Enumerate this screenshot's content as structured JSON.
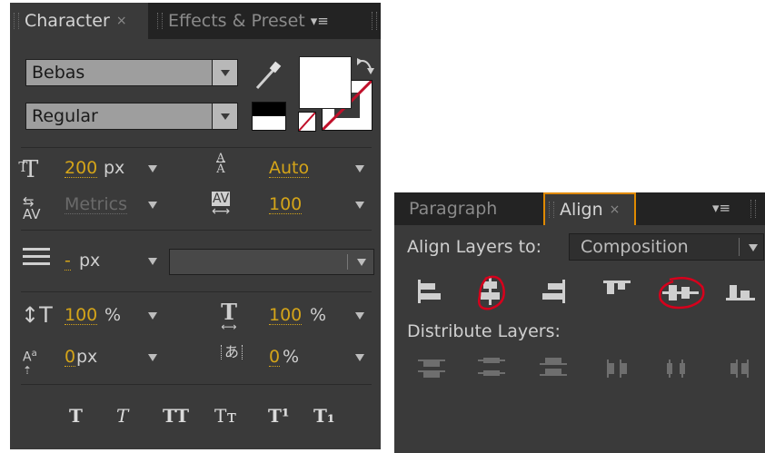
{
  "character_panel": {
    "tabs": [
      {
        "label": "Character",
        "close": "×"
      },
      {
        "label": "Effects & Preset",
        "menu": "▾≡"
      }
    ],
    "font_family": "Bebas",
    "font_style": "Regular",
    "font_size": {
      "value": "200",
      "unit": "px"
    },
    "leading": {
      "value": "Auto"
    },
    "kerning": {
      "value": "Metrics"
    },
    "tracking": {
      "value": "100"
    },
    "stroke_width": {
      "value": "-",
      "unit": "px"
    },
    "vertical_scale": {
      "value": "100",
      "unit": "%"
    },
    "horizontal_scale": {
      "value": "100",
      "unit": "%"
    },
    "baseline_shift": {
      "value": "0",
      "unit": "px"
    },
    "tsume": {
      "value": "0",
      "unit": "%"
    },
    "style_buttons": [
      "T",
      "T",
      "TT",
      "Tт",
      "T¹",
      "T₁"
    ],
    "colors": {
      "fill": "#ffffff",
      "swatch_black": "#000000",
      "swatch_white": "#ffffff",
      "accent": "#d4a419",
      "none_slash": "#c0102a"
    }
  },
  "align_panel": {
    "tabs": [
      {
        "label": "Paragraph"
      },
      {
        "label": "Align",
        "close": "×"
      }
    ],
    "menu_icon": "▾≡",
    "align_to_label": "Align Layers to:",
    "align_to_value": "Composition",
    "distribute_label": "Distribute Layers:",
    "align_icons": [
      "align-left-icon",
      "align-horizontal-center-icon",
      "align-right-icon",
      "align-top-icon",
      "align-vertical-center-icon",
      "align-bottom-icon"
    ],
    "distribute_icons": [
      "distribute-top-icon",
      "distribute-vcenter-icon",
      "distribute-bottom-icon",
      "distribute-left-icon",
      "distribute-hcenter-icon",
      "distribute-right-icon"
    ],
    "colors": {
      "highlight_ring": "#d6001c",
      "active_tab_border": "#e08a00"
    }
  }
}
